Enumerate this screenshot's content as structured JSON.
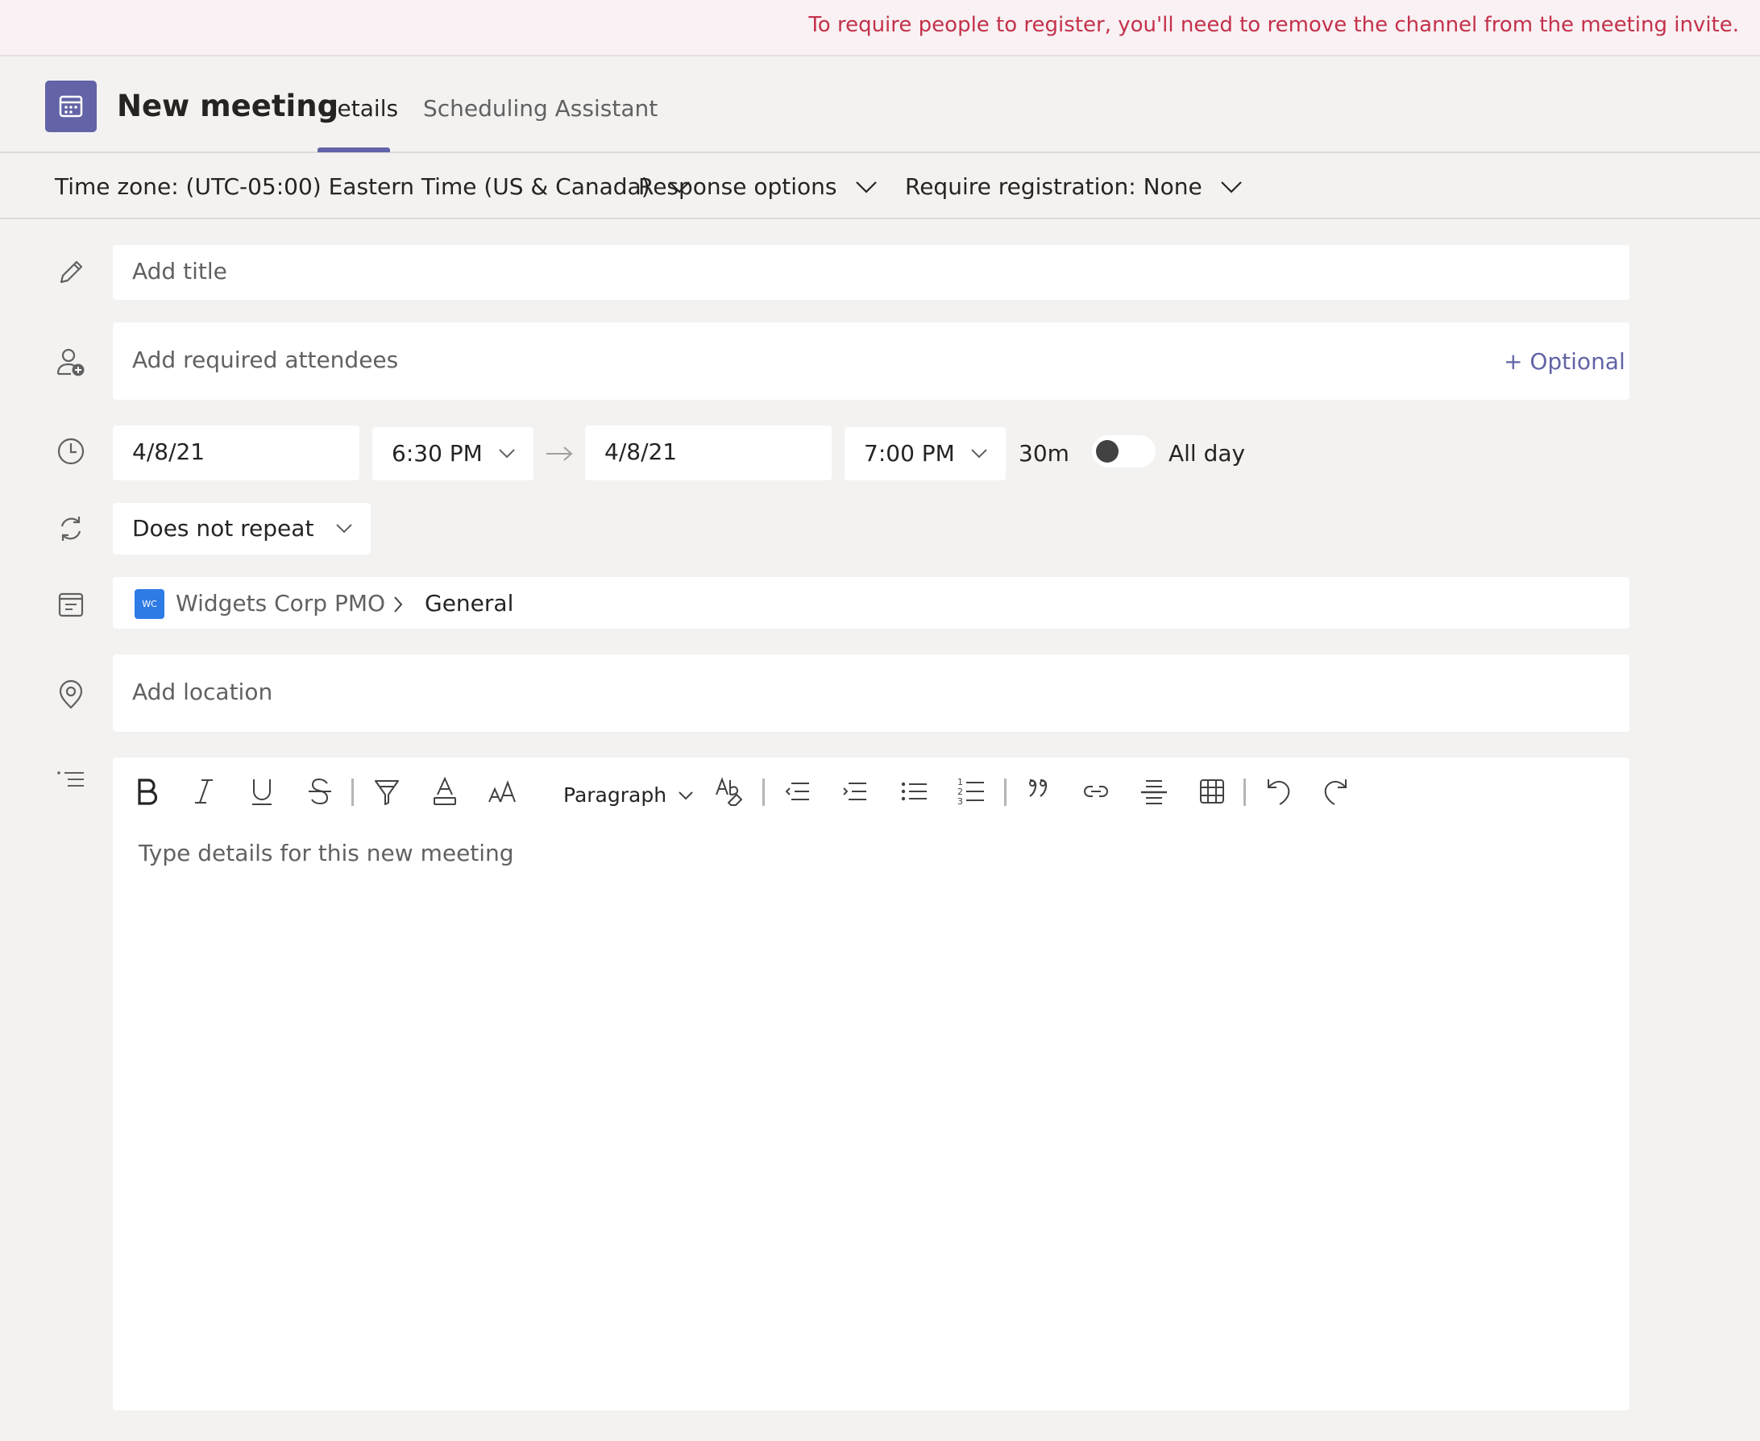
{
  "banner": {
    "message": "To require people to register, you'll need to remove the channel from the meeting invite."
  },
  "header": {
    "title": "New meeting",
    "tabs": [
      {
        "label": "Details",
        "active": true
      },
      {
        "label": "Scheduling Assistant",
        "active": false
      }
    ]
  },
  "options": {
    "timezone": "Time zone: (UTC-05:00) Eastern Time (US & Canada)",
    "response": "Response options",
    "registration": "Require registration: None"
  },
  "form": {
    "title_placeholder": "Add title",
    "attendees_placeholder": "Add required attendees",
    "optional_link": "+ Optional",
    "start_date": "4/8/21",
    "start_time": "6:30 PM",
    "end_date": "4/8/21",
    "end_time": "7:00 PM",
    "duration": "30m",
    "all_day_label": "All day",
    "all_day_on": false,
    "repeat": "Does not repeat",
    "channel": {
      "badge": "WC",
      "team": "Widgets Corp PMO",
      "name": "General"
    },
    "location_placeholder": "Add location"
  },
  "editor": {
    "paragraph_label": "Paragraph",
    "placeholder": "Type details for this new meeting"
  },
  "icons": [
    "calendar-icon",
    "chevron-down-icon",
    "pencil-icon",
    "add-person-icon",
    "clock-icon",
    "arrow-right-icon",
    "repeat-icon",
    "channel-icon",
    "location-icon",
    "details-list-icon",
    "bold-icon",
    "italic-icon",
    "underline-icon",
    "strikethrough-icon",
    "highlight-icon",
    "font-color-icon",
    "font-size-icon",
    "spellcheck-icon",
    "decrease-indent-icon",
    "increase-indent-icon",
    "bulleted-list-icon",
    "numbered-list-icon",
    "quote-icon",
    "link-icon",
    "horizontal-rule-icon",
    "table-icon",
    "undo-icon",
    "redo-icon"
  ],
  "colors": {
    "brand": "#6264a7",
    "warning_text": "#c4314b",
    "background": "#f3f2f1",
    "field": "#ffffff",
    "channel_badge": "#2f7be6"
  }
}
